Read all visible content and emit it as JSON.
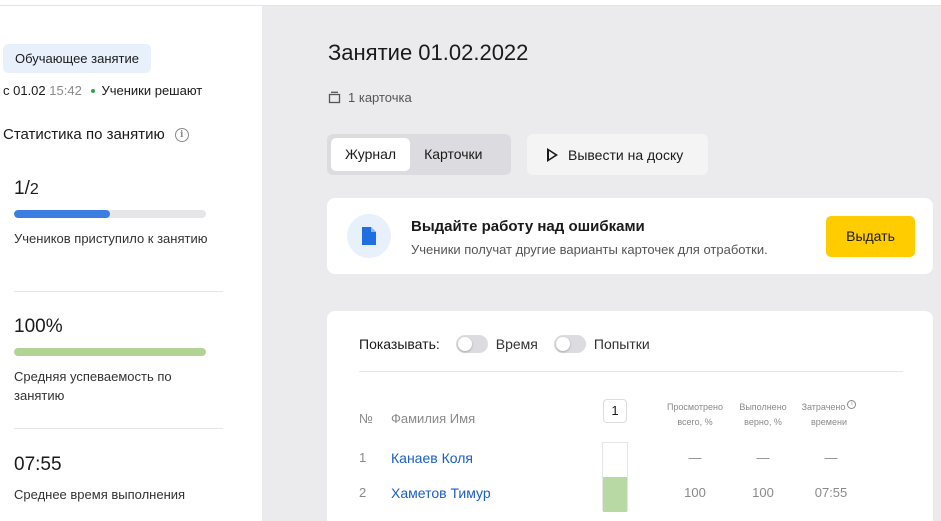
{
  "sidebar": {
    "badge": "Обучающее занятие",
    "since_prefix": "с 01.02",
    "since_time": "15:42",
    "status": "Ученики решают",
    "stats_title": "Статистика по занятию",
    "stats": [
      {
        "value": "1/",
        "denominator": "2",
        "progress": 0.5,
        "bar_color": "#3b7ee0",
        "label": "Учеников приступило к занятию"
      },
      {
        "value": "100%",
        "progress": 1.0,
        "bar_color": "#b3d395",
        "label": "Средняя успеваемость по занятию"
      },
      {
        "value": "07:55",
        "label": "Среднее время выполнения"
      }
    ]
  },
  "main": {
    "title": "Занятие 01.02.2022",
    "cards_count": "1 карточка",
    "tabs": [
      {
        "label": "Журнал",
        "active": true
      },
      {
        "label": "Карточки",
        "active": false
      }
    ],
    "board_button": "Вывести на доску",
    "banner": {
      "title": "Выдайте работу над ошибками",
      "subtitle": "Ученики получат другие варианты карточек для отработки.",
      "button": "Выдать"
    },
    "journal": {
      "show_label": "Показывать:",
      "toggles": [
        {
          "label": "Время",
          "on": false
        },
        {
          "label": "Попытки",
          "on": false
        }
      ],
      "columns": {
        "num": "№",
        "name": "Фамилия Имя",
        "card": "1",
        "viewed_line1": "Просмотрено",
        "viewed_line2": "всего, %",
        "correct_line1": "Выполнено",
        "correct_line2": "верно, %",
        "spent_line1": "Затрачено",
        "spent_line2": "времени"
      },
      "rows": [
        {
          "num": "1",
          "name": "Канаев Коля",
          "viewed": "—",
          "correct": "—",
          "spent": "—"
        },
        {
          "num": "2",
          "name": "Хаметов Тимур",
          "viewed": "100",
          "correct": "100",
          "spent": "07:55"
        }
      ]
    }
  }
}
